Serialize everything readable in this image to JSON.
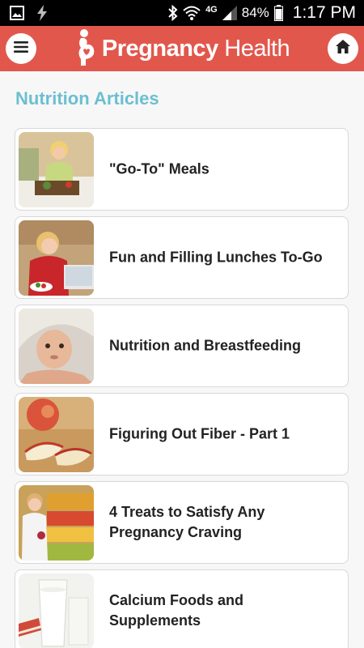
{
  "status_bar": {
    "network": "4G",
    "battery": "84%",
    "time": "1:17 PM"
  },
  "header": {
    "brand_bold": "Pregnancy",
    "brand_light": "Health",
    "menu_icon": "hamburger-menu-icon",
    "home_icon": "home-icon"
  },
  "section": {
    "title": "Nutrition Articles"
  },
  "articles": [
    {
      "title": "\"Go-To\" Meals",
      "image": "woman-cooking-kitchen"
    },
    {
      "title": "Fun and Filling Lunches To-Go",
      "image": "woman-eating-at-laptop"
    },
    {
      "title": "Nutrition and Breastfeeding",
      "image": "baby-in-blanket"
    },
    {
      "title": "Figuring Out Fiber - Part 1",
      "image": "apple-slices"
    },
    {
      "title": "4 Treats to Satisfy Any Pregnancy Craving",
      "image": "woman-at-fruit-market"
    },
    {
      "title": "Calcium Foods and Supplements",
      "image": "glass-of-milk"
    }
  ],
  "colors": {
    "header": "#e2574c",
    "section_title": "#6bbfd0",
    "background": "#f7f7f7"
  }
}
